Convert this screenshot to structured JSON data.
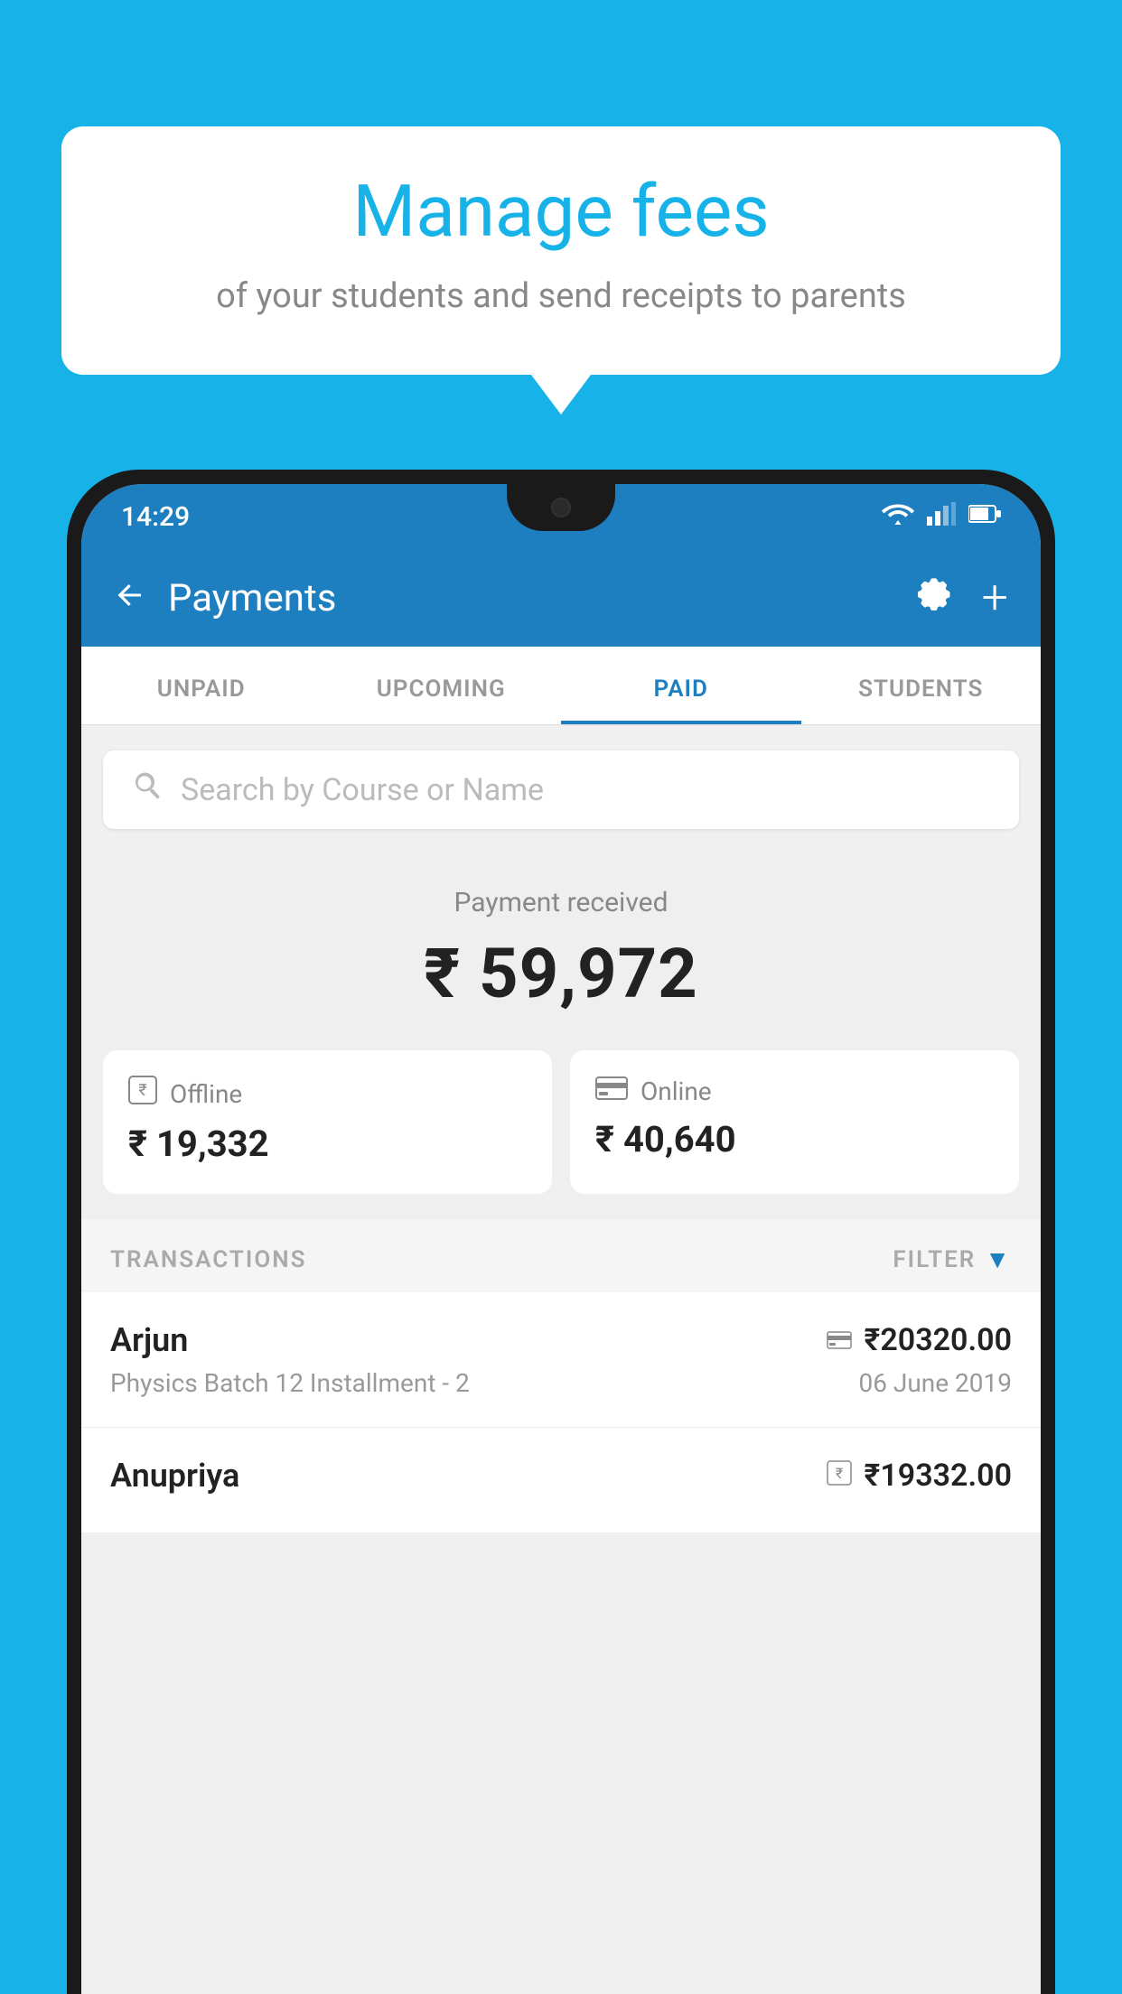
{
  "background_color": "#17b3e8",
  "bubble": {
    "title": "Manage fees",
    "subtitle": "of your students and send receipts to parents"
  },
  "status_bar": {
    "time": "14:29"
  },
  "app_bar": {
    "title": "Payments"
  },
  "tabs": [
    {
      "id": "unpaid",
      "label": "UNPAID",
      "active": false
    },
    {
      "id": "upcoming",
      "label": "UPCOMING",
      "active": false
    },
    {
      "id": "paid",
      "label": "PAID",
      "active": true
    },
    {
      "id": "students",
      "label": "STUDENTS",
      "active": false
    }
  ],
  "search": {
    "placeholder": "Search by Course or Name"
  },
  "payment_received": {
    "label": "Payment received",
    "amount": "₹ 59,972"
  },
  "cards": [
    {
      "id": "offline",
      "label": "Offline",
      "amount": "₹ 19,332",
      "icon": "rupee-square"
    },
    {
      "id": "online",
      "label": "Online",
      "amount": "₹ 40,640",
      "icon": "card"
    }
  ],
  "transactions_label": "TRANSACTIONS",
  "filter_label": "FILTER",
  "transactions": [
    {
      "name": "Arjun",
      "course": "Physics Batch 12 Installment - 2",
      "amount": "₹20320.00",
      "date": "06 June 2019",
      "payment_type": "card"
    },
    {
      "name": "Anupriya",
      "course": "",
      "amount": "₹19332.00",
      "date": "",
      "payment_type": "rupee"
    }
  ]
}
